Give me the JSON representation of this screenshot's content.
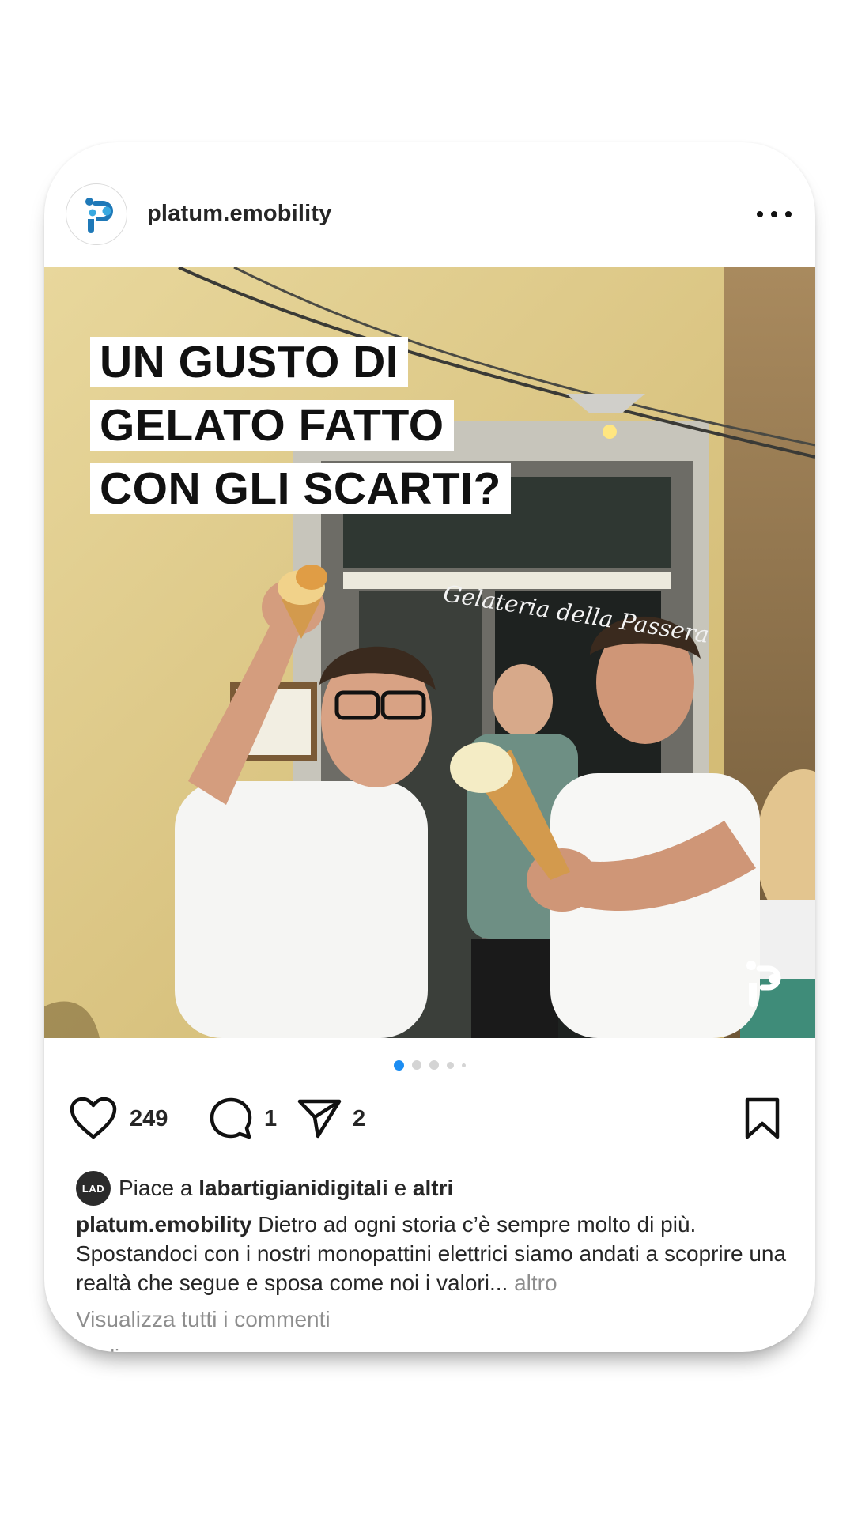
{
  "post": {
    "username": "platum.emobility",
    "headline": [
      "UN GUSTO DI",
      "GELATO FATTO",
      "CON GLI SCARTI?"
    ],
    "shop_sign": "Gelateria della Passera",
    "carousel": {
      "count": 5,
      "active_index": 0
    },
    "actions": {
      "likes": "249",
      "comments": "1",
      "shares": "2"
    },
    "liked_by": {
      "avatar_text": "LAD",
      "prefix": "Piace a",
      "user": "labartigianidigitali",
      "conjunction": "e",
      "others": "altri"
    },
    "caption": {
      "author": "platum.emobility",
      "text": "Dietro ad ogni storia c’è sempre molto di più. Spostandoci con i nostri monopattini elettrici siamo andati a scoprire una realtà che segue e sposa come noi i valori...",
      "more": "altro"
    },
    "view_comments": "Visualizza tutti i commenti",
    "cut_text": "Luglio"
  },
  "colors": {
    "accent": "#1c8df2",
    "brand": "#1f79b8",
    "text": "#262626",
    "muted": "#8e8e8e"
  },
  "icons": [
    "more-icon",
    "heart-icon",
    "comment-icon",
    "share-icon",
    "bookmark-icon"
  ]
}
